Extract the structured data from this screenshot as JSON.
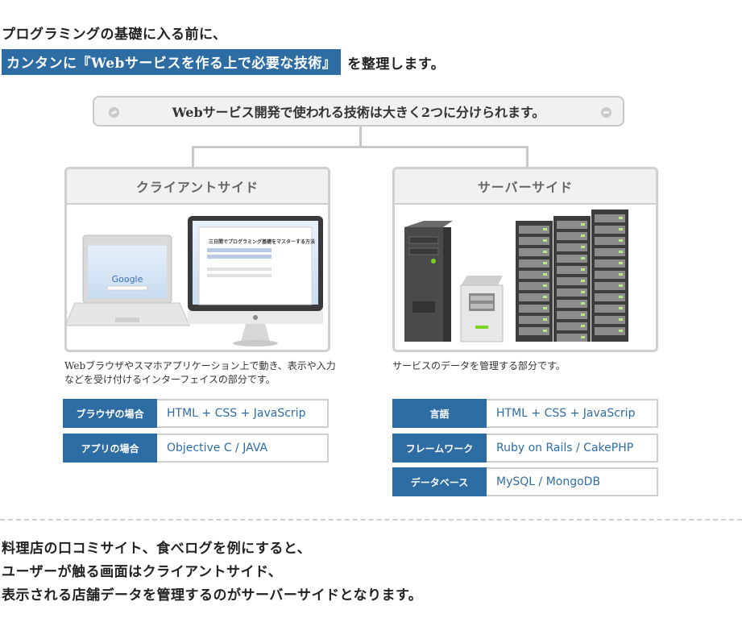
{
  "intro": {
    "line1": "プログラミングの基礎に入る前に、",
    "highlight": "カンタンに『Webサービスを作る上で必要な技術』",
    "line2_rest": "を整理します。"
  },
  "top_box": {
    "text": "Webサービス開発で使われる技術は大きく2つに分けられます。"
  },
  "client": {
    "title": "クライアントサイド",
    "description": "Webブラウザやスマホアプリケーション上で動き、表示や入力などを受け付けるインターフェイスの部分です。",
    "laptop_logo": "Google",
    "monitor_heading": "三日間でプログラミング基礎をマスターする方法",
    "rows": [
      {
        "key": "ブラウザの場合",
        "value": "HTML + CSS + JavaScrip"
      },
      {
        "key": "アプリの場合",
        "value": "Objective C / JAVA"
      }
    ]
  },
  "server": {
    "title": "サーバーサイド",
    "description": "サービスのデータを管理する部分です。",
    "rows": [
      {
        "key": "言語",
        "value": "HTML + CSS + JavaScrip"
      },
      {
        "key": "フレームワーク",
        "value": "Ruby on Rails / CakePHP"
      },
      {
        "key": "データベース",
        "value": "MySQL / MongoDB"
      }
    ]
  },
  "outro": {
    "line1": "料理店の口コミサイト、食べログを例にすると、",
    "line2": "ユーザーが触る画面はクライアントサイド、",
    "line3": "表示される店舗データを管理するのがサーバーサイドとなります。"
  },
  "colors": {
    "accent": "#2e6da4",
    "border": "#cfcfcf",
    "panel_bg": "#f1f1f1"
  },
  "icons": {
    "top_left": "minus-circle-icon",
    "top_right": "minus-circle-icon"
  }
}
